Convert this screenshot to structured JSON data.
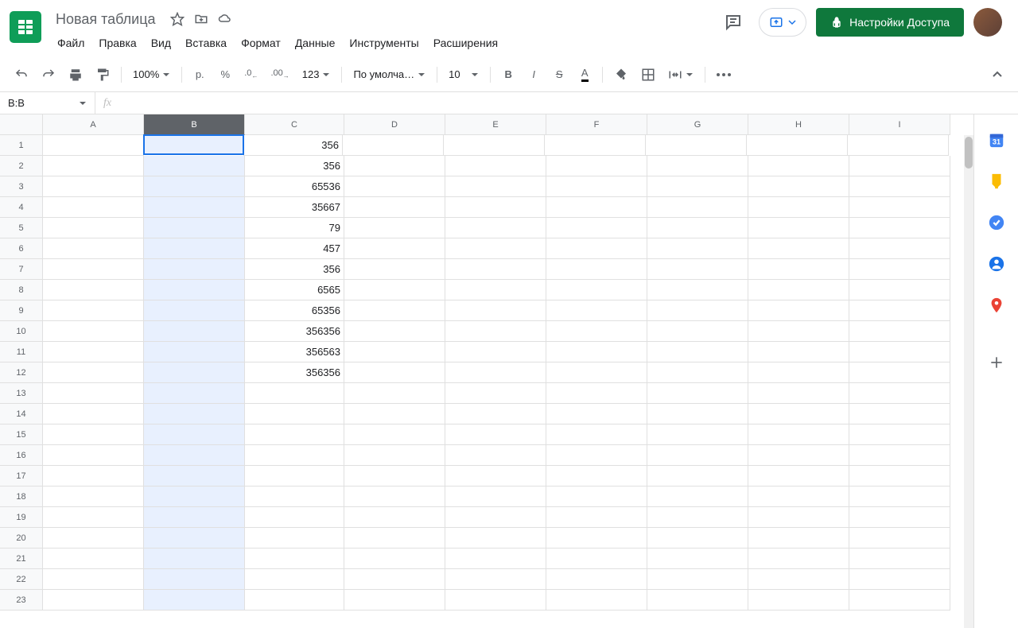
{
  "doc": {
    "title": "Новая таблица"
  },
  "menu": {
    "file": "Файл",
    "edit": "Правка",
    "view": "Вид",
    "insert": "Вставка",
    "format": "Формат",
    "data": "Данные",
    "tools": "Инструменты",
    "extensions": "Расширения"
  },
  "share": {
    "label": "Настройки Доступа"
  },
  "toolbar": {
    "zoom": "100%",
    "currency": "р.",
    "percent": "%",
    "dec_dec": ".0",
    "dec_inc": ".00",
    "numfmt": "123",
    "font": "По умолча…",
    "size": "10"
  },
  "namebox": {
    "ref": "B:B"
  },
  "columns": [
    "A",
    "B",
    "C",
    "D",
    "E",
    "F",
    "G",
    "H",
    "I"
  ],
  "rowCount": 23,
  "selectedColIndex": 1,
  "activeCell": {
    "row": 0,
    "col": 1
  },
  "cells": {
    "C1": "356",
    "C2": "356",
    "C3": "65536",
    "C4": "35667",
    "C5": "79",
    "C6": "457",
    "C7": "356",
    "C8": "6565",
    "C9": "65356",
    "C10": "356356",
    "C11": "356563",
    "C12": "356356"
  }
}
